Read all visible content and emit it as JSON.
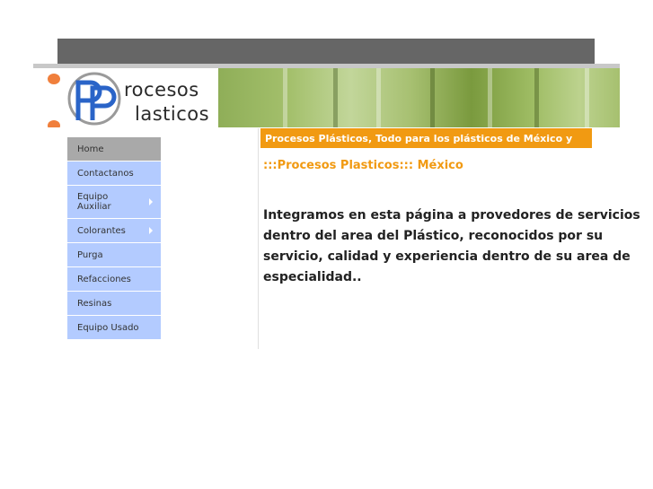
{
  "logo": {
    "word1": "rocesos",
    "word2": "lasticos",
    "mark": "PP"
  },
  "nav": {
    "items": [
      {
        "label": "Home"
      },
      {
        "label": "Contactanos"
      },
      {
        "label": "Equipo Auxiliar"
      },
      {
        "label": "Colorantes"
      },
      {
        "label": "Purga"
      },
      {
        "label": "Refacciones"
      },
      {
        "label": "Resinas"
      },
      {
        "label": "Equipo Usado"
      }
    ]
  },
  "content": {
    "marquee": "Procesos Plásticos, Todo para los plásticos de México y",
    "subtitle": ":::Procesos Plasticos::: México",
    "intro": "Integramos en esta página a provedores de servicios dentro del area del Plástico, reconocidos por su servicio, calidad y experiencia dentro de su area de especialidad.."
  },
  "colors": {
    "accent": "#f19a12",
    "nav_bg": "#b3cbff",
    "nav_active": "#a9a9a9",
    "logo_dot": "#f07f3c"
  }
}
